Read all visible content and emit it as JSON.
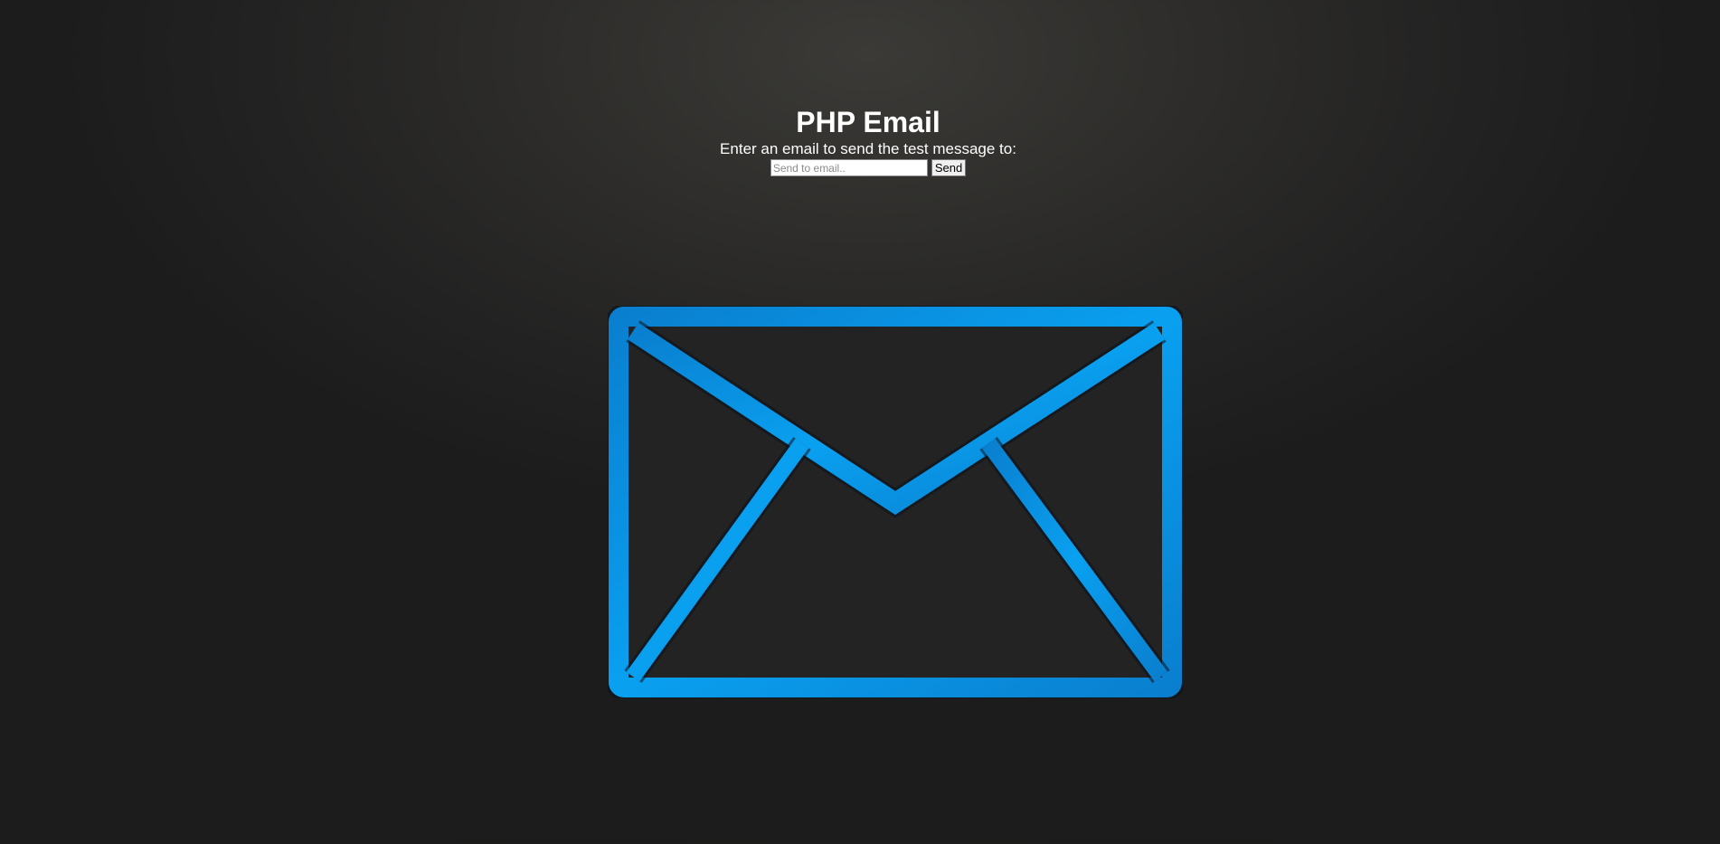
{
  "page": {
    "title": "PHP Email",
    "prompt": "Enter an email to send the test message to:"
  },
  "form": {
    "email_placeholder": "Send to email..",
    "email_value": "",
    "send_label": "Send"
  },
  "illustration": {
    "icon": "envelope-icon",
    "color": "#0a8fe0",
    "background": "#232323"
  }
}
